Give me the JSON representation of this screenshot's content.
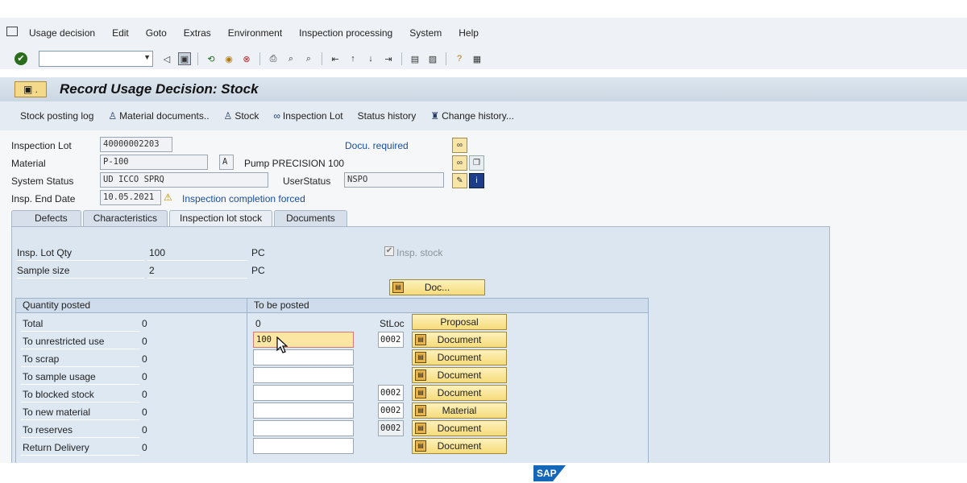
{
  "menubar": {
    "items": [
      "Usage decision",
      "Edit",
      "Goto",
      "Extras",
      "Environment",
      "Inspection processing",
      "System",
      "Help"
    ]
  },
  "toolbar": {
    "command_value": ""
  },
  "title": {
    "text": "Record Usage Decision: Stock"
  },
  "app_toolbar": {
    "stock_posting_log": "Stock posting log",
    "material_documents": "Material documents..",
    "stock": "Stock",
    "inspection_lot": "Inspection Lot",
    "status_history": "Status history",
    "change_history": "Change history..."
  },
  "header": {
    "inspection_lot_label": "Inspection Lot",
    "inspection_lot_value": "40000002203",
    "docu_required": "Docu. required",
    "material_label": "Material",
    "material_value": "P-100",
    "material_flag": "A",
    "material_desc": "Pump PRECISION 100",
    "system_status_label": "System Status",
    "system_status_value": "UD   ICCO SPRQ",
    "user_status_label": "UserStatus",
    "user_status_value": "NSPO",
    "insp_end_date_label": "Insp. End Date",
    "insp_end_date_value": "10.05.2021",
    "completion_note": "Inspection completion forced"
  },
  "tabs": [
    "Defects",
    "Characteristics",
    "Inspection lot stock",
    "Documents"
  ],
  "lot_stock": {
    "insp_lot_qty_label": "Insp. Lot Qty",
    "insp_lot_qty_value": "100",
    "insp_lot_qty_unit": "PC",
    "sample_size_label": "Sample size",
    "sample_size_value": "2",
    "sample_size_unit": "PC",
    "insp_stock_label": "Insp. stock",
    "doc_button": "Doc..."
  },
  "quantity_posted": {
    "header": "Quantity posted",
    "rows": [
      {
        "label": "Total",
        "value": "0"
      },
      {
        "label": "To unrestricted use",
        "value": "0"
      },
      {
        "label": "To scrap",
        "value": "0"
      },
      {
        "label": "To sample usage",
        "value": "0"
      },
      {
        "label": "To blocked stock",
        "value": "0"
      },
      {
        "label": "To new material",
        "value": "0"
      },
      {
        "label": "To reserves",
        "value": "0"
      },
      {
        "label": "Return Delivery",
        "value": "0"
      }
    ]
  },
  "to_be_posted": {
    "header": "To be posted",
    "total_value": "0",
    "stloc_label": "StLoc",
    "proposal_button": "Proposal",
    "inputs": [
      "100",
      "",
      "",
      "",
      "",
      "",
      ""
    ],
    "slocs": [
      "0002",
      "",
      "",
      "0002",
      "0002",
      "0002",
      ""
    ],
    "buttons": [
      "Document",
      "Document",
      "Document",
      "Document",
      "Material",
      "Document",
      "Document"
    ]
  },
  "footer": {
    "logo_text": "SAP"
  }
}
